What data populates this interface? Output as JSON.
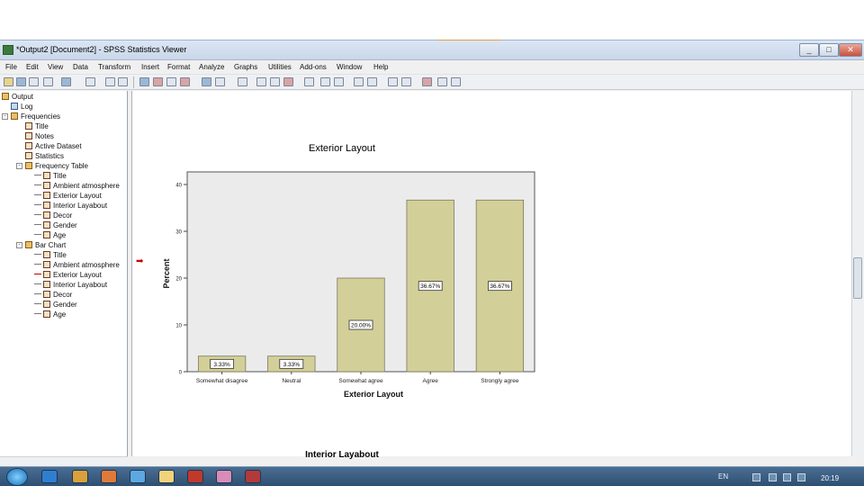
{
  "window": {
    "title": "*Output2 [Document2] - SPSS Statistics Viewer",
    "controls": {
      "minimize": "_",
      "maximize": "□",
      "close": "✕"
    }
  },
  "menu": [
    "File",
    "Edit",
    "View",
    "Data",
    "Transform",
    "Insert",
    "Format",
    "Analyze",
    "Graphs",
    "Utilities",
    "Add-ons",
    "Window",
    "Help"
  ],
  "outline": {
    "rows": [
      {
        "label": "Output",
        "indent": 0,
        "icon": "book"
      },
      {
        "label": "Log",
        "indent": 1,
        "icon": "log"
      },
      {
        "label": "Frequencies",
        "indent": 1,
        "icon": "book"
      },
      {
        "label": "Title",
        "indent": 2,
        "icon": "item"
      },
      {
        "label": "Notes",
        "indent": 2,
        "icon": "item"
      },
      {
        "label": "Active Dataset",
        "indent": 2,
        "icon": "item"
      },
      {
        "label": "Statistics",
        "indent": 2,
        "icon": "item"
      },
      {
        "label": "Frequency Table",
        "indent": 2,
        "icon": "book"
      },
      {
        "label": "Title",
        "indent": 3,
        "icon": "item"
      },
      {
        "label": "Ambient atmosphere",
        "indent": 3,
        "icon": "item"
      },
      {
        "label": "Exterior Layout",
        "indent": 3,
        "icon": "item"
      },
      {
        "label": "Interior Layabout",
        "indent": 3,
        "icon": "item"
      },
      {
        "label": "Decor",
        "indent": 3,
        "icon": "item"
      },
      {
        "label": "Gender",
        "indent": 3,
        "icon": "item"
      },
      {
        "label": "Age",
        "indent": 3,
        "icon": "item"
      },
      {
        "label": "Bar Chart",
        "indent": 2,
        "icon": "book"
      },
      {
        "label": "Title",
        "indent": 3,
        "icon": "item"
      },
      {
        "label": "Ambient atmosphere",
        "indent": 3,
        "icon": "item"
      },
      {
        "label": "Exterior Layout",
        "indent": 3,
        "icon": "item",
        "selected": true
      },
      {
        "label": "Interior Layabout",
        "indent": 3,
        "icon": "item"
      },
      {
        "label": "Decor",
        "indent": 3,
        "icon": "item"
      },
      {
        "label": "Gender",
        "indent": 3,
        "icon": "item"
      },
      {
        "label": "Age",
        "indent": 3,
        "icon": "item"
      }
    ]
  },
  "chart_data": {
    "type": "bar",
    "title": "Exterior Layout",
    "xlabel": "Exterior Layout",
    "ylabel": "Percent",
    "categories": [
      "Somewhat disagree",
      "Neutral",
      "Somewhat agree",
      "Agree",
      "Strongly agree"
    ],
    "values": [
      3.33,
      3.33,
      20.0,
      36.67,
      36.67
    ],
    "data_labels": [
      "3.33%",
      "3.33%",
      "20.00%",
      "36.67%",
      "36.67%"
    ],
    "ylim": [
      0,
      40
    ],
    "yticks": [
      0,
      10,
      20,
      30,
      40
    ],
    "bar_color": "#d3cf98",
    "plot_background": "#ebebeb",
    "grid": false
  },
  "next_chart_title": "Interior Layabout",
  "taskbar": {
    "language": "EN",
    "clock": "20:19"
  }
}
